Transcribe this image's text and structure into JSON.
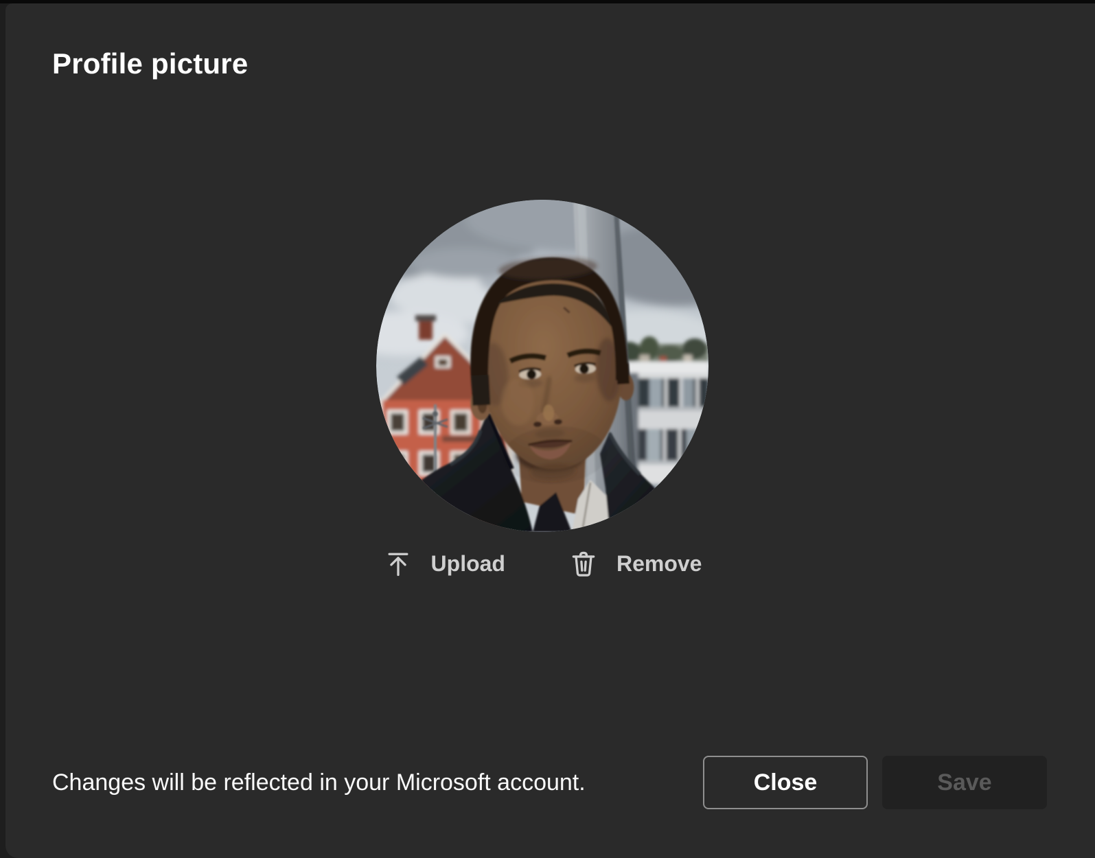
{
  "dialog": {
    "title": "Profile picture",
    "actions": {
      "upload": {
        "label": "Upload",
        "icon": "upload-arrow-icon"
      },
      "remove": {
        "label": "Remove",
        "icon": "trash-icon"
      }
    },
    "footer": {
      "note": "Changes will be reflected in your Microsoft account.",
      "close_label": "Close",
      "save_label": "Save",
      "save_enabled": false
    },
    "colors": {
      "page_bg": "#1e1e1e",
      "dialog_bg": "#2a2a2a",
      "text_primary": "#ffffff",
      "action_text": "#cfcfcf",
      "close_border": "#8f8f8f",
      "save_bg": "#212121",
      "save_text": "#5a5a5a"
    }
  }
}
